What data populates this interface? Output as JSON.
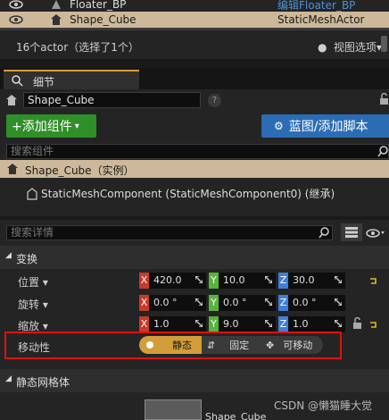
{
  "outliner": {
    "rows": [
      {
        "name": "Floater_BP",
        "type": "编辑Floater_BP"
      },
      {
        "name": "Shape_Cube",
        "type": "StaticMeshActor"
      }
    ],
    "count_text": "16个actor（选择了1个）",
    "view_options": "视图选项"
  },
  "details_tab": {
    "label": "细节"
  },
  "actor_name": "Shape_Cube",
  "help_glyph": "?",
  "toolbar": {
    "add_component": "+添加组件",
    "blueprint_script": "蓝图/添加脚本"
  },
  "component_search": {
    "placeholder": "搜索组件"
  },
  "components": {
    "root": "Shape_Cube（实例）",
    "child": "StaticMeshComponent (StaticMeshComponent0) (继承)"
  },
  "details_search": {
    "placeholder": "搜索详情"
  },
  "transform": {
    "header": "变换",
    "location": {
      "label": "位置",
      "x": "420.0",
      "y": "10.0",
      "z": "30.0"
    },
    "rotation": {
      "label": "旋转",
      "x": "0.0 °",
      "y": "0.0 °",
      "z": "0.0 °"
    },
    "scale": {
      "label": "缩放",
      "x": "1.0",
      "y": "9.0",
      "z": "1.0"
    },
    "axis_x": "X",
    "axis_y": "Y",
    "axis_z": "Z"
  },
  "mobility": {
    "label": "移动性",
    "options": [
      "静态",
      "固定",
      "可移动"
    ],
    "selected": "静态"
  },
  "static_mesh": {
    "header": "静态网格体",
    "value": "Shape_Cube"
  },
  "watermark": "CSDN @懒猫睡大觉",
  "colors": {
    "selection": "#cdb99a",
    "add_button": "#2f8f28",
    "blueprint_button": "#2a6db4",
    "mobility_active": "#d39e3a",
    "highlight_box": "#e01010"
  }
}
